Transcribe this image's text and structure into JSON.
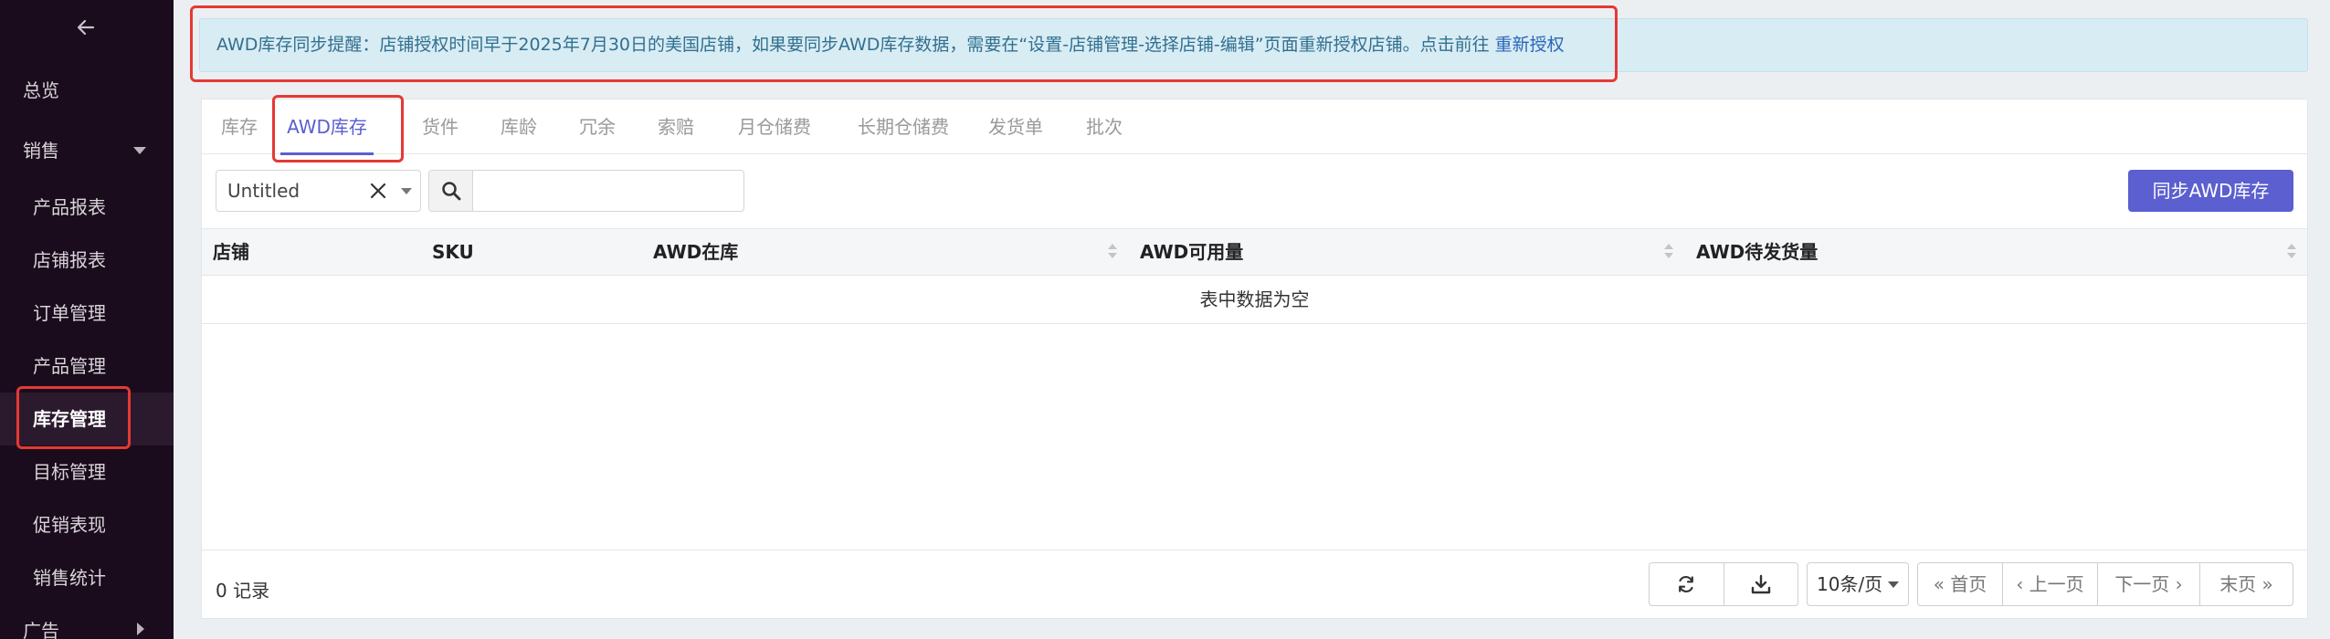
{
  "sidebar": {
    "back_icon": "arrow-left-icon",
    "items": [
      {
        "label": "总览"
      },
      {
        "label": "销售",
        "icon": "caret-down-icon"
      },
      {
        "label": "产品报表"
      },
      {
        "label": "店铺报表"
      },
      {
        "label": "订单管理"
      },
      {
        "label": "产品管理"
      },
      {
        "label": "库存管理",
        "active": true
      },
      {
        "label": "目标管理"
      },
      {
        "label": "促销表现"
      },
      {
        "label": "销售统计"
      },
      {
        "label": "广告",
        "icon": "caret-right-icon"
      }
    ]
  },
  "alert": {
    "text": "AWD库存同步提醒：店铺授权时间早于2025年7月30日的美国店铺，如果要同步AWD库存数据，需要在“设置-店铺管理-选择店铺-编辑”页面重新授权店铺。点击前往",
    "link": "重新授权"
  },
  "tabs": [
    "库存",
    "AWD库存",
    "货件",
    "库龄",
    "冗余",
    "索赔",
    "月仓储费",
    "长期仓储费",
    "发货单",
    "批次"
  ],
  "active_tab": "AWD库存",
  "toolbar": {
    "store_select_value": "Untitled",
    "search_placeholder": "",
    "sync_button": "同步AWD库存"
  },
  "table": {
    "columns": [
      "店铺",
      "SKU",
      "AWD在库",
      "AWD可用量",
      "AWD待发货量"
    ],
    "empty_text": "表中数据为空"
  },
  "footer": {
    "records": "0 记录",
    "page_size": "10条/页",
    "first": "首页",
    "prev": "上一页",
    "next": "下一页",
    "last": "末页"
  },
  "colors": {
    "sidebar_bg": "#1a0c1c",
    "accent": "#5b5fcf",
    "alert_bg": "#d8ecf4",
    "highlight": "#e53935"
  }
}
